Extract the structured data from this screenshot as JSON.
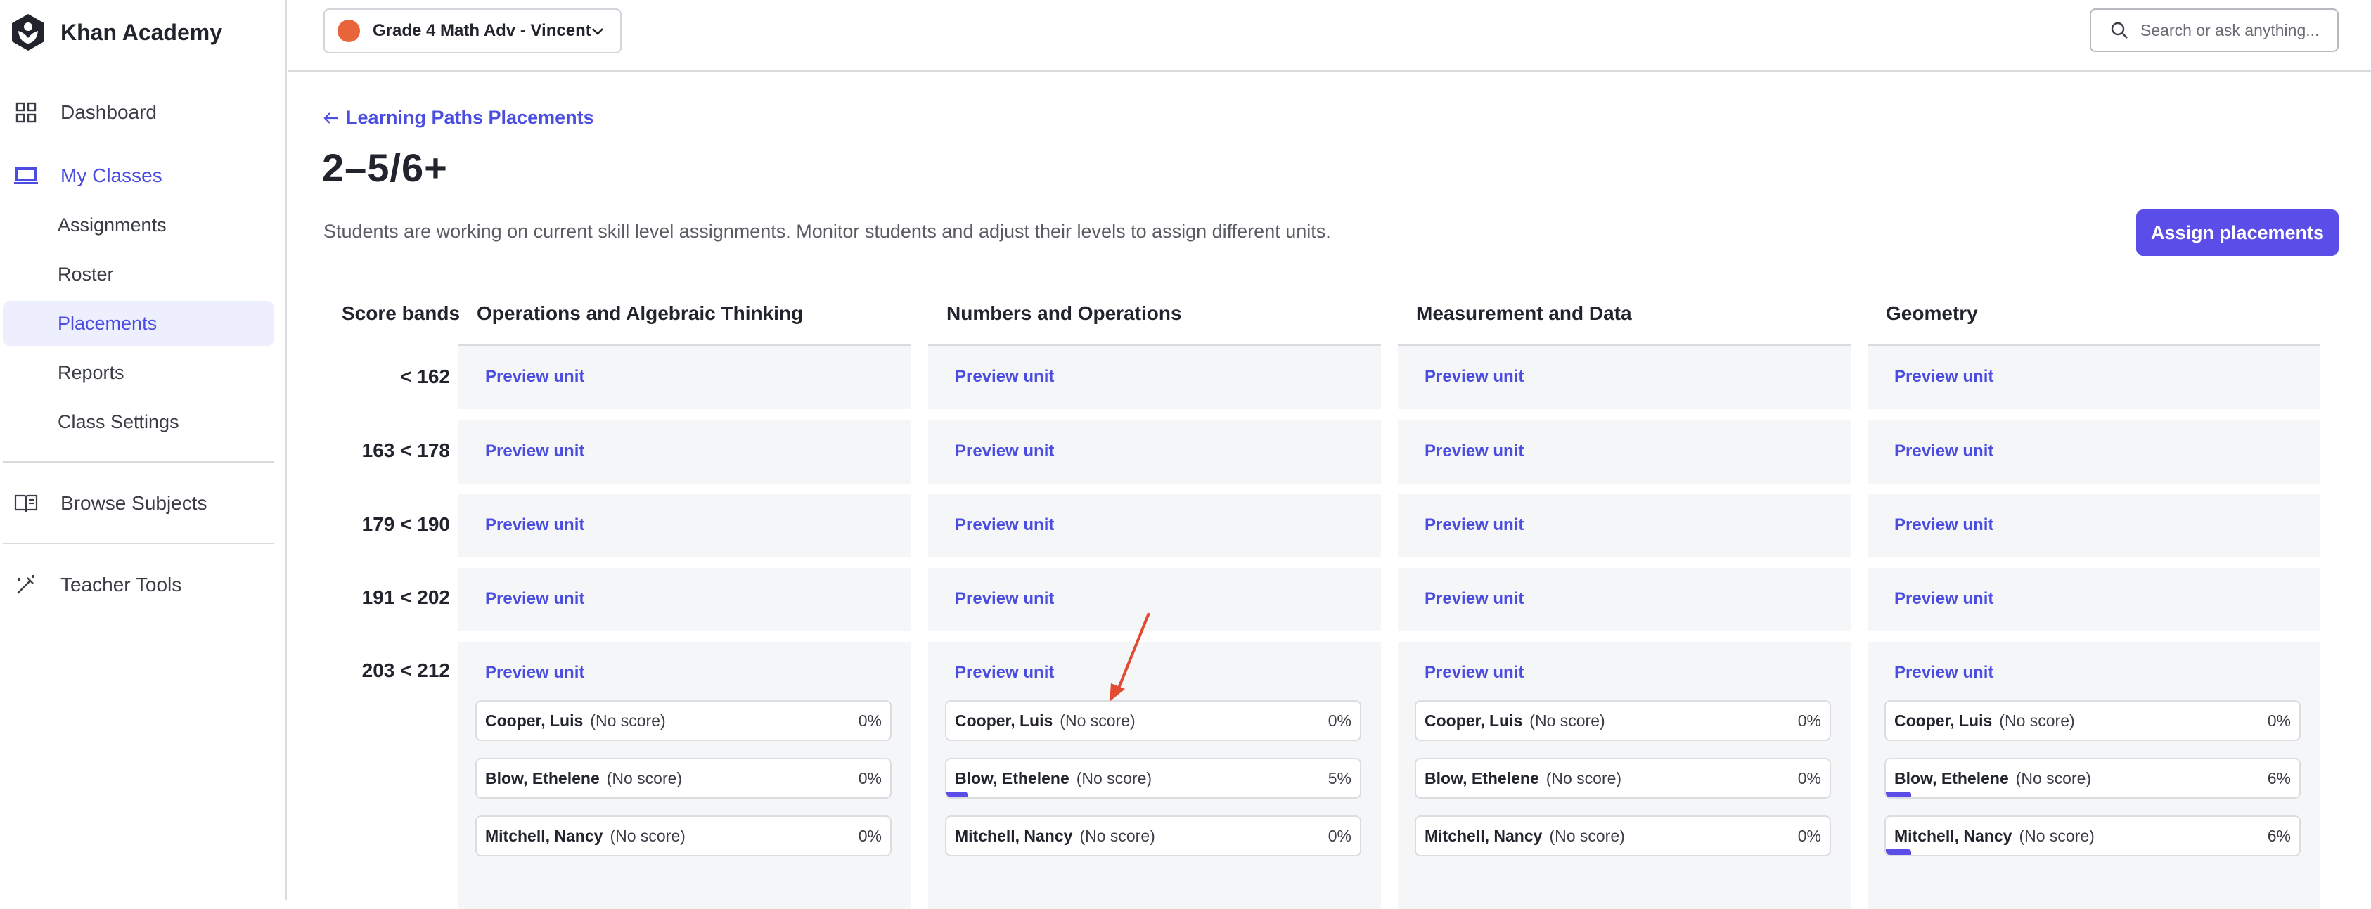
{
  "app": {
    "name": "Khan Academy"
  },
  "sidebar": {
    "items": [
      {
        "label": "Dashboard",
        "icon": "grid-icon"
      },
      {
        "label": "My Classes",
        "icon": "classroom-icon"
      },
      {
        "label": "Assignments"
      },
      {
        "label": "Roster"
      },
      {
        "label": "Placements"
      },
      {
        "label": "Reports"
      },
      {
        "label": "Class Settings"
      },
      {
        "label": "Browse Subjects",
        "icon": "book-icon"
      },
      {
        "label": "Teacher Tools",
        "icon": "magic-wand-icon"
      }
    ]
  },
  "topbar": {
    "class_name": "Grade 4 Math Adv - Vincent",
    "class_color": "#e8643b",
    "search_placeholder": "Search or ask anything..."
  },
  "main": {
    "back_label": "Learning Paths Placements",
    "title": "2–5/6+",
    "description": "Students are working on current skill level assignments. Monitor students and adjust their levels to assign different units.",
    "assign_button": "Assign placements",
    "accent_color": "#5b4de8",
    "score_bands_header": "Score bands",
    "columns": [
      "Operations and Algebraic Thinking",
      "Numbers and Operations",
      "Measurement and Data",
      "Geometry"
    ],
    "bands": [
      "< 162",
      "163 < 178",
      "179 < 190",
      "191 < 202",
      "203 < 212"
    ],
    "preview_label": "Preview unit",
    "students": [
      {
        "name": "Cooper, Luis",
        "score": "(No score)",
        "progress": [
          "0%",
          "0%",
          "0%",
          "0%"
        ],
        "progress_fraction": [
          0,
          0,
          0,
          0
        ]
      },
      {
        "name": "Blow, Ethelene",
        "score": "(No score)",
        "progress": [
          "0%",
          "5%",
          "0%",
          "6%"
        ],
        "progress_fraction": [
          0,
          0.05,
          0,
          0.06
        ]
      },
      {
        "name": "Mitchell, Nancy",
        "score": "(No score)",
        "progress": [
          "0%",
          "0%",
          "0%",
          "6%"
        ],
        "progress_fraction": [
          0,
          0,
          0,
          0.06
        ]
      }
    ]
  }
}
